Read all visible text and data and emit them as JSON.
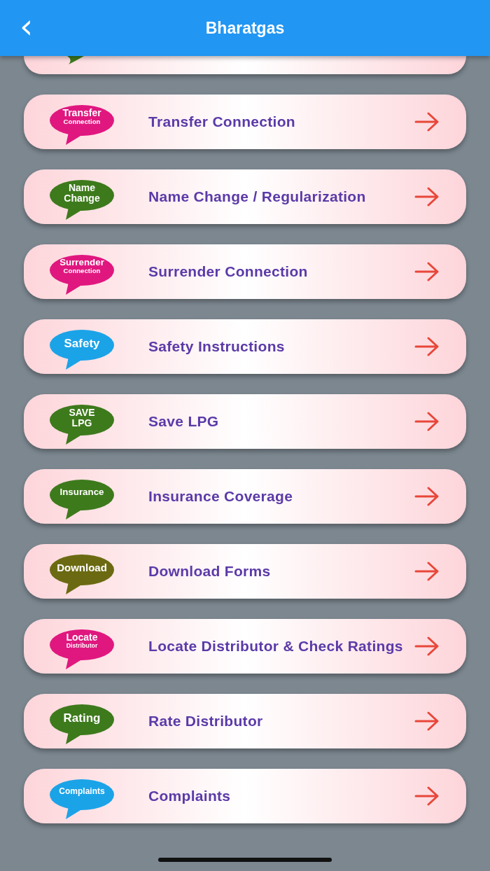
{
  "app_bar": {
    "title": "Bharatgas",
    "back": "‹"
  },
  "items": [
    {
      "label": "Transfer Connection",
      "badge": [
        "Transfer",
        "Connection"
      ],
      "color": "#e0177f"
    },
    {
      "label": "Name Change / Regularization",
      "badge": [
        "Name",
        "Change"
      ],
      "color": "#3d7a1c"
    },
    {
      "label": "Surrender Connection",
      "badge": [
        "Surrender",
        "Connection"
      ],
      "color": "#e0177f"
    },
    {
      "label": "Safety Instructions",
      "badge": [
        "Safety"
      ],
      "color": "#1ba3e8"
    },
    {
      "label": "Save LPG",
      "badge": [
        "SAVE",
        "LPG"
      ],
      "color": "#3d7a1c"
    },
    {
      "label": "Insurance Coverage",
      "badge": [
        "Insurance"
      ],
      "color": "#3d7a1c"
    },
    {
      "label": "Download Forms",
      "badge": [
        "Download"
      ],
      "color": "#6b6a12"
    },
    {
      "label": "Locate Distributor & Check Ratings",
      "badge": [
        "Locate",
        "Distributor"
      ],
      "color": "#e0177f"
    },
    {
      "label": "Rate Distributor",
      "badge": [
        "Rating"
      ],
      "color": "#3d7a1c"
    },
    {
      "label": "Complaints",
      "badge": [
        "Complaints"
      ],
      "color": "#1ba3e8"
    }
  ]
}
